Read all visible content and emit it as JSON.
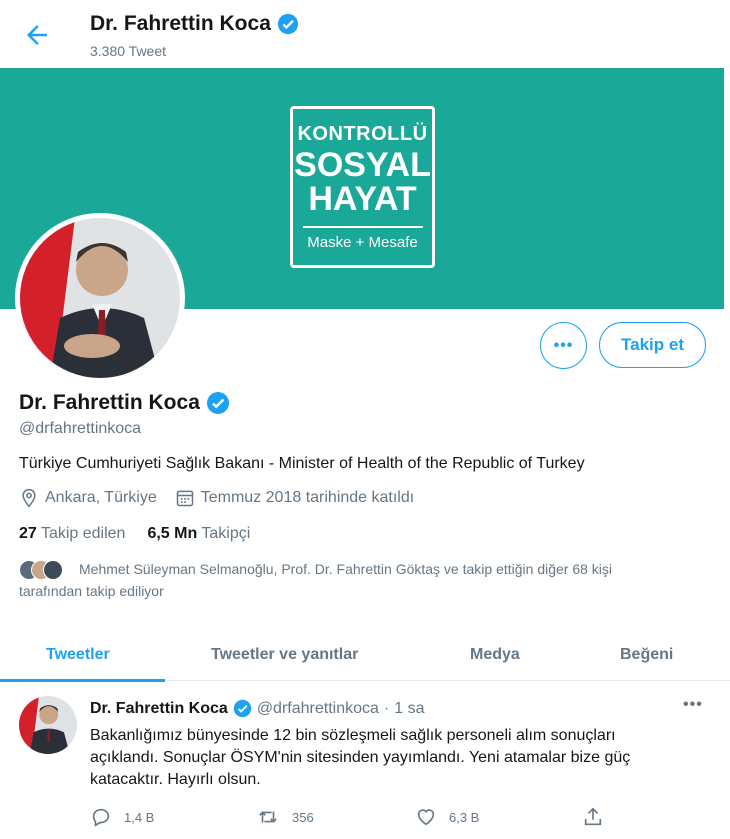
{
  "header": {
    "name": "Dr. Fahrettin Koca",
    "tweet_count": "3.380 Tweet"
  },
  "banner": {
    "line1": "KONTROLLÜ",
    "line2": "SOSYAL",
    "line3": "HAYAT",
    "line4": "Maske + Mesafe",
    "bg_color": "#1aa998"
  },
  "actions": {
    "more_label": "•••",
    "follow_label": "Takip et"
  },
  "profile": {
    "name": "Dr. Fahrettin Koca",
    "handle": "@drfahrettinkoca",
    "bio": "Türkiye Cumhuriyeti Sağlık Bakanı - Minister of Health of the Republic of Turkey",
    "location": "Ankara, Türkiye",
    "joined": "Temmuz 2018 tarihinde katıldı",
    "following_count": "27",
    "following_label": "Takip edilen",
    "followers_count": "6,5 Mn",
    "followers_label": "Takipçi",
    "followed_by_line1": "Mehmet Süleyman Selmanoğlu, Prof. Dr. Fahrettin Göktaş ve takip ettiğin diğer 68 kişi",
    "followed_by_line2": "tarafından takip ediliyor"
  },
  "tabs": [
    {
      "label": "Tweetler",
      "active": true
    },
    {
      "label": "Tweetler ve yanıtlar",
      "active": false
    },
    {
      "label": "Medya",
      "active": false
    },
    {
      "label": "Beğeni",
      "active": false
    }
  ],
  "tweet": {
    "name": "Dr. Fahrettin Koca",
    "handle": "@drfahrettinkoca",
    "dot": "·",
    "time": "1 sa",
    "menu": "•••",
    "text_line1": "Bakanlığımız bünyesinde 12 bin sözleşmeli sağlık personeli alım sonuçları",
    "text_line2": "açıklandı. Sonuçlar ÖSYM'nin sitesinden yayımlandı. Yeni atamalar bize güç",
    "text_line3": "katacaktır. Hayırlı olsun.",
    "replies": "1,4 B",
    "retweets": "356",
    "likes": "6,3 B"
  },
  "colors": {
    "accent": "#1da1f2",
    "muted": "#657786",
    "text": "#14171a",
    "verified": "#1da1f2"
  },
  "icons": {
    "back": "arrow-left-icon",
    "verified": "verified-badge-icon",
    "location": "location-pin-icon",
    "calendar": "calendar-icon",
    "reply": "reply-icon",
    "retweet": "retweet-icon",
    "like": "heart-icon",
    "share": "share-icon"
  }
}
